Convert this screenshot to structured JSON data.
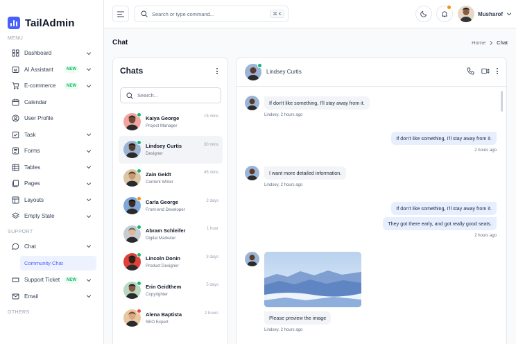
{
  "brand": {
    "name": "TailAdmin",
    "color": "#465fff"
  },
  "sidebar": {
    "menu_label": "MENU",
    "support_label": "SUPPORT",
    "others_label": "OTHERS",
    "items": [
      {
        "label": "Dashboard",
        "icon": "grid-icon",
        "badge": "",
        "chevron": true
      },
      {
        "label": "AI Assistant",
        "icon": "ai-icon",
        "badge": "NEW",
        "chevron": true
      },
      {
        "label": "E-commerce",
        "icon": "cart-icon",
        "badge": "NEW",
        "chevron": true
      },
      {
        "label": "Calendar",
        "icon": "calendar-icon",
        "badge": "",
        "chevron": false
      },
      {
        "label": "User Profile",
        "icon": "user-icon",
        "badge": "",
        "chevron": false
      },
      {
        "label": "Task",
        "icon": "task-icon",
        "badge": "",
        "chevron": true
      },
      {
        "label": "Forms",
        "icon": "form-icon",
        "badge": "",
        "chevron": true
      },
      {
        "label": "Tables",
        "icon": "table-icon",
        "badge": "",
        "chevron": true
      },
      {
        "label": "Pages",
        "icon": "pages-icon",
        "badge": "",
        "chevron": true
      },
      {
        "label": "Layouts",
        "icon": "layout-icon",
        "badge": "",
        "chevron": true
      },
      {
        "label": "Empty State",
        "icon": "empty-state-icon",
        "badge": "",
        "chevron": true
      }
    ],
    "support_items": [
      {
        "label": "Chat",
        "icon": "chat-icon",
        "badge": "",
        "chevron": true
      },
      {
        "label": "Support Ticket",
        "icon": "ticket-icon",
        "badge": "NEW",
        "chevron": true
      },
      {
        "label": "Email",
        "icon": "mail-icon",
        "badge": "",
        "chevron": true
      }
    ],
    "chat_sub_item": "Community Chat"
  },
  "header": {
    "search_placeholder": "Search or type command...",
    "shortcut": "⌘ K",
    "user_name": "Musharof"
  },
  "page": {
    "title": "Chat",
    "breadcrumb_home": "Home",
    "breadcrumb_current": "Chat"
  },
  "chats": {
    "title": "Chats",
    "search_placeholder": "Search...",
    "contacts": [
      {
        "name": "Kaiya George",
        "role": "Project Manager",
        "time": "15 mins",
        "status_color": "#12b76a",
        "avatar_bg": "#f4a4a0",
        "active": false
      },
      {
        "name": "Lindsey Curtis",
        "role": "Designer",
        "time": "30 mins",
        "status_color": "#12b76a",
        "avatar_bg": "#9bb4d6",
        "active": true
      },
      {
        "name": "Zain Geidt",
        "role": "Content Writer",
        "time": "45 mins",
        "status_color": "#12b76a",
        "avatar_bg": "#d9c7a8",
        "active": false
      },
      {
        "name": "Carla George",
        "role": "Front-end Developer",
        "time": "2 days",
        "status_color": "#f79009",
        "avatar_bg": "#7fa8d8",
        "active": false
      },
      {
        "name": "Abram Schleifer",
        "role": "Digital Marketer",
        "time": "1 hour",
        "status_color": "#12b76a",
        "avatar_bg": "#c7ccd4",
        "active": false
      },
      {
        "name": "Lincoln Donin",
        "role": "Product Designer",
        "time": "3 days",
        "status_color": "#12b76a",
        "avatar_bg": "#e0413a",
        "active": false
      },
      {
        "name": "Erin Geidthem",
        "role": "Copyrighter",
        "time": "5 days",
        "status_color": "#12b76a",
        "avatar_bg": "#b8d8c4",
        "active": false
      },
      {
        "name": "Alena Baptista",
        "role": "SEO Expert",
        "time": "2 hours",
        "status_color": "#f04438",
        "avatar_bg": "#e8c8a0",
        "active": false
      }
    ]
  },
  "conversation": {
    "contact_name": "Lindsey Curtis",
    "messages": [
      {
        "dir": "in",
        "text": "If don't like something, I'll stay away from it.",
        "meta": "Lindsey, 2 hours ago"
      },
      {
        "dir": "out",
        "text": "If don't like something, I'll stay away from it.",
        "meta": "2 hours ago"
      },
      {
        "dir": "in",
        "text": "I want more detailed information.",
        "meta": "Lindsey, 2 hours ago"
      },
      {
        "dir": "out",
        "text": "If don't like something, I'll stay away from it.",
        "meta": ""
      },
      {
        "dir": "out",
        "text": "They got there early, and got really good seats.",
        "meta": "2 hours ago"
      },
      {
        "dir": "in",
        "text": "Please preview the image",
        "meta": "Lindsey, 2 hours ago"
      }
    ]
  }
}
